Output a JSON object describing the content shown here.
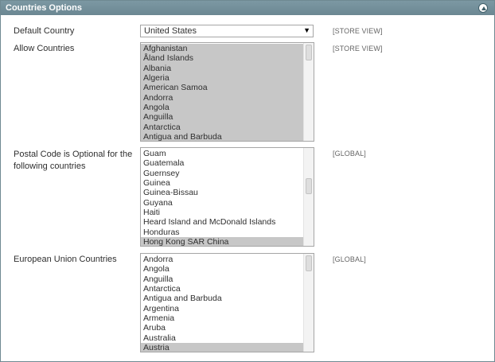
{
  "panel": {
    "title": "Countries Options"
  },
  "default_country": {
    "label": "Default Country",
    "value": "United States",
    "scope": "[STORE VIEW]"
  },
  "allow_countries": {
    "label": "Allow Countries",
    "scope": "[STORE VIEW]",
    "options": [
      "Afghanistan",
      "Åland Islands",
      "Albania",
      "Algeria",
      "American Samoa",
      "Andorra",
      "Angola",
      "Anguilla",
      "Antarctica",
      "Antigua and Barbuda"
    ]
  },
  "postal_code_optional": {
    "label_line1": "Postal Code is Optional for the",
    "label_line2": "following countries",
    "scope": "[GLOBAL]",
    "options": [
      "Guam",
      "Guatemala",
      "Guernsey",
      "Guinea",
      "Guinea-Bissau",
      "Guyana",
      "Haiti",
      "Heard Island and McDonald Islands",
      "Honduras",
      "Hong Kong SAR China"
    ],
    "selected": "Hong Kong SAR China"
  },
  "eu_countries": {
    "label": "European Union Countries",
    "scope": "[GLOBAL]",
    "options": [
      "Andorra",
      "Angola",
      "Anguilla",
      "Antarctica",
      "Antigua and Barbuda",
      "Argentina",
      "Armenia",
      "Aruba",
      "Australia",
      "Austria"
    ],
    "selected": "Austria"
  },
  "icons": {
    "collapse": "collapse-up-icon",
    "dropdown": "chevron-down-icon"
  },
  "colors": {
    "header_bg": "#7390a0",
    "selection_bg": "#c7c7c7"
  }
}
